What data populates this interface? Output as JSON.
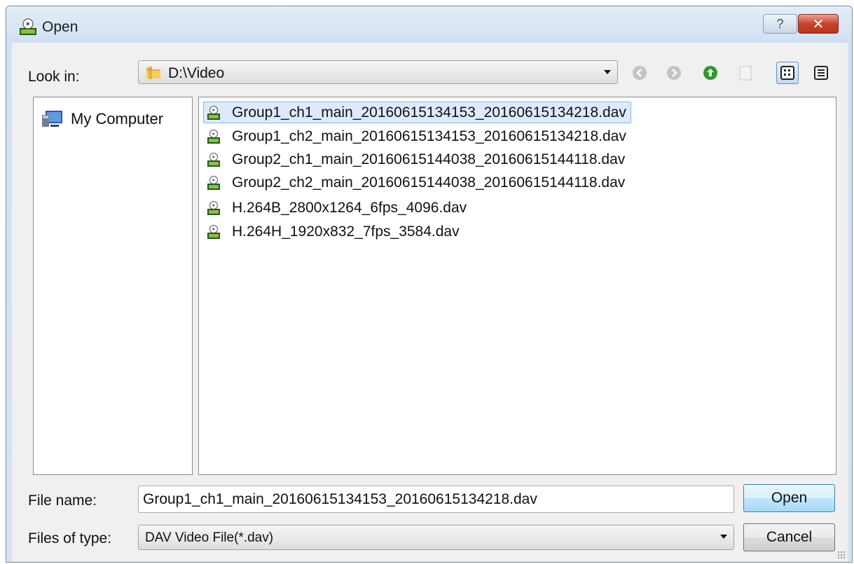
{
  "window": {
    "title": "Open",
    "help_glyph": "?",
    "close_glyph": "✕"
  },
  "toolbar": {
    "look_in_label": "Look in:",
    "look_in_value": "D:\\Video",
    "icons": [
      "back-icon",
      "forward-icon",
      "up-folder-icon",
      "new-folder-icon",
      "list-view-icon",
      "detail-view-icon"
    ]
  },
  "places": {
    "items": [
      {
        "label": "My Computer",
        "icon": "computer-icon"
      }
    ]
  },
  "files": {
    "items": [
      {
        "name": "Group1_ch1_main_20160615134153_20160615134218.dav",
        "selected": true
      },
      {
        "name": "Group1_ch2_main_20160615134153_20160615134218.dav",
        "selected": false
      },
      {
        "name": "Group2_ch1_main_20160615144038_20160615144118.dav",
        "selected": false
      },
      {
        "name": "Group2_ch2_main_20160615144038_20160615144118.dav",
        "selected": false
      },
      {
        "name": "H.264B_2800x1264_6fps_4096.dav",
        "selected": false
      },
      {
        "name": "H.264H_1920x832_7fps_3584.dav",
        "selected": false
      }
    ]
  },
  "footer": {
    "file_name_label": "File name:",
    "file_name_value": "Group1_ch1_main_20160615134153_20160615134218.dav",
    "file_type_label": "Files of type:",
    "file_type_value": "DAV Video File(*.dav)",
    "open_label": "Open",
    "cancel_label": "Cancel"
  },
  "colors": {
    "selection": "#dcebfc",
    "close_button": "#c9442c",
    "up_arrow": "#2e9a2e"
  }
}
